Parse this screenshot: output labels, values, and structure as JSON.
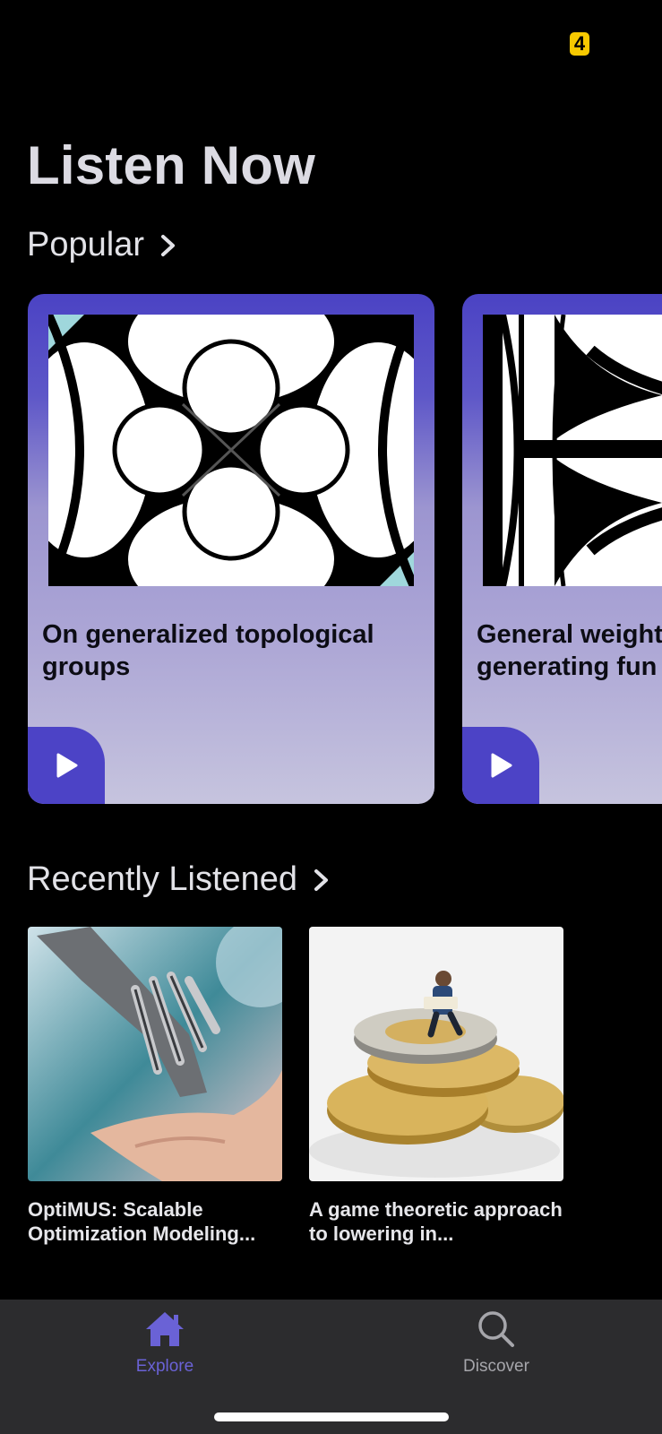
{
  "status_bar": {
    "battery_level": "4"
  },
  "page_title": "Listen Now",
  "popular": {
    "header": "Popular",
    "cards": [
      {
        "title": "On generalized topological groups"
      },
      {
        "title": "General weight and relative inf generating fun"
      }
    ]
  },
  "recently_listened": {
    "header": "Recently Listened",
    "items": [
      {
        "title": "OptiMUS: Scalable Optimization Modeling..."
      },
      {
        "title": "A game theoretic approach to lowering in..."
      }
    ]
  },
  "tab_bar": {
    "tabs": [
      {
        "label": "Explore",
        "icon": "home-icon",
        "active": true
      },
      {
        "label": "Discover",
        "icon": "search-icon",
        "active": false
      }
    ]
  },
  "colors": {
    "accent": "#6a62d6",
    "card_top": "#4b43c4",
    "card_bottom": "#c6c4de",
    "tab_bar_bg": "#2c2c2e",
    "inactive_tab": "#a6a6ab"
  }
}
